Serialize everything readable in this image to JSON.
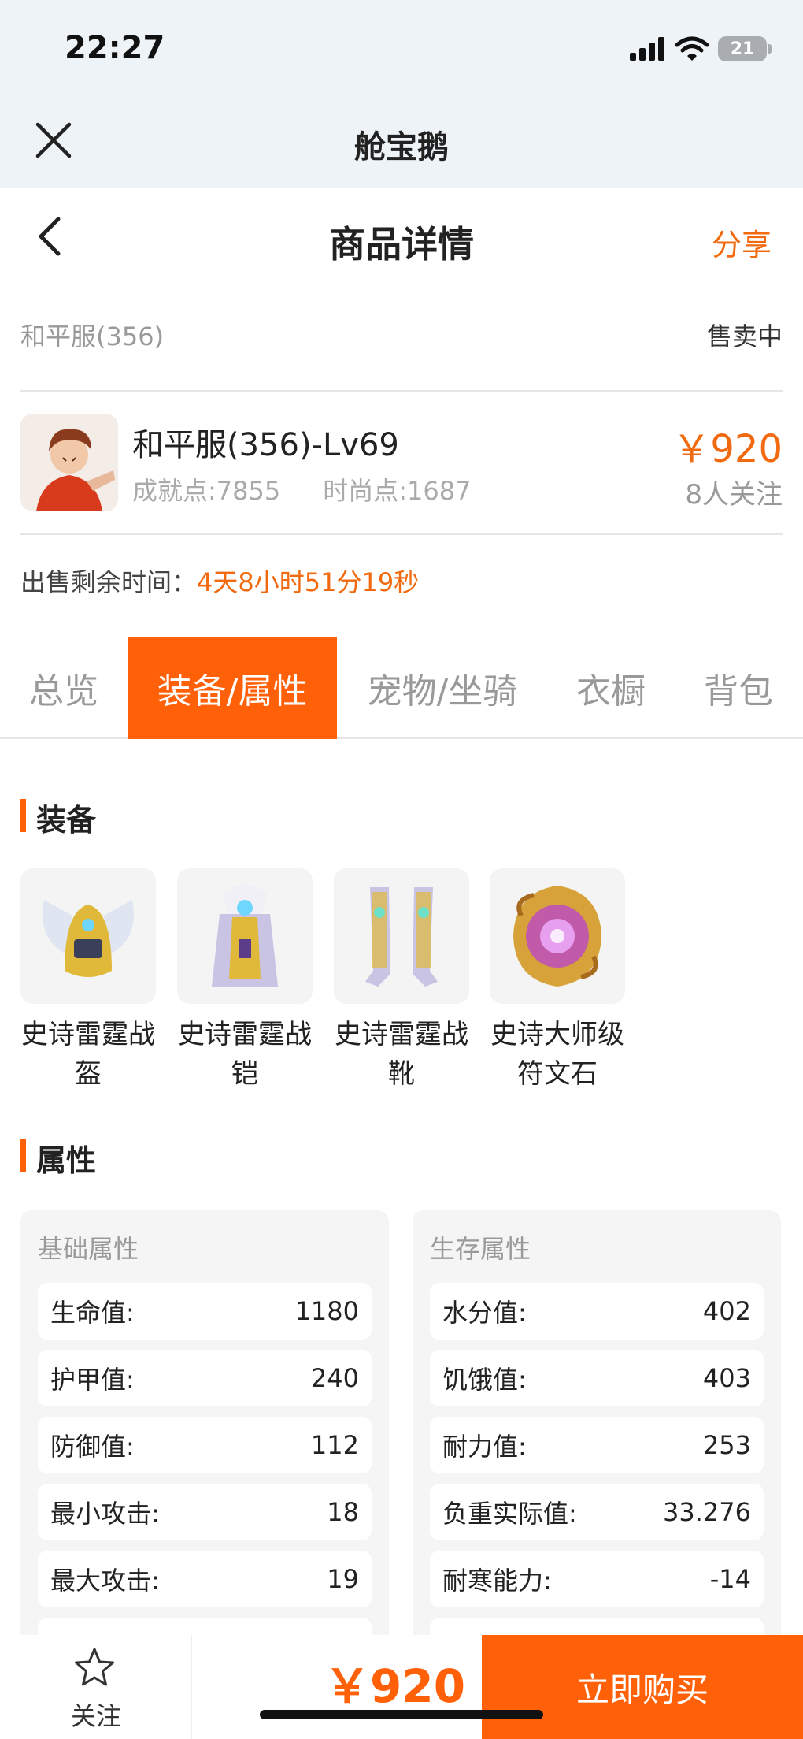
{
  "status_bar": {
    "time": "22:27",
    "battery": "21"
  },
  "mini_app": {
    "title": "舱宝鹅"
  },
  "navbar": {
    "title": "商品详情",
    "share": "分享"
  },
  "listing": {
    "server": "和平服(356)",
    "status": "售卖中",
    "name": "和平服(356)-Lv69",
    "achievement": "成就点:7855",
    "fashion": "时尚点:1687",
    "price": "￥920",
    "followers": "8人关注",
    "remaining_label": "出售剩余时间：",
    "remaining_value": "4天8小时51分19秒"
  },
  "tabs": [
    "总览",
    "装备/属性",
    "宠物/坐骑",
    "衣橱",
    "背包"
  ],
  "active_tab": "装备/属性",
  "equipment": {
    "title": "装备",
    "items": [
      {
        "line1": "史诗雷霆战",
        "line2": "盔",
        "icon": "helmet-icon"
      },
      {
        "line1": "史诗雷霆战",
        "line2": "铠",
        "icon": "armor-icon"
      },
      {
        "line1": "史诗雷霆战",
        "line2": "靴",
        "icon": "boots-icon"
      },
      {
        "line1": "史诗大师级",
        "line2": "符文石",
        "icon": "rune-stone-icon"
      }
    ]
  },
  "attributes": {
    "title": "属性",
    "basic": {
      "title": "基础属性",
      "rows": [
        {
          "label": "生命值:",
          "value": "1180"
        },
        {
          "label": "护甲值:",
          "value": "240"
        },
        {
          "label": "防御值:",
          "value": "112"
        },
        {
          "label": "最小攻击:",
          "value": "18"
        },
        {
          "label": "最大攻击:",
          "value": "19"
        }
      ]
    },
    "survival": {
      "title": "生存属性",
      "rows": [
        {
          "label": "水分值:",
          "value": "402"
        },
        {
          "label": "饥饿值:",
          "value": "403"
        },
        {
          "label": "耐力值:",
          "value": "253"
        },
        {
          "label": "负重实际值:",
          "value": "33.276"
        },
        {
          "label": "耐寒能力:",
          "value": "-14"
        }
      ]
    }
  },
  "bottom": {
    "follow": "关注",
    "price": "￥920",
    "buy": "立即购买"
  },
  "colors": {
    "accent": "#ff6008",
    "price": "#f26a0f"
  }
}
